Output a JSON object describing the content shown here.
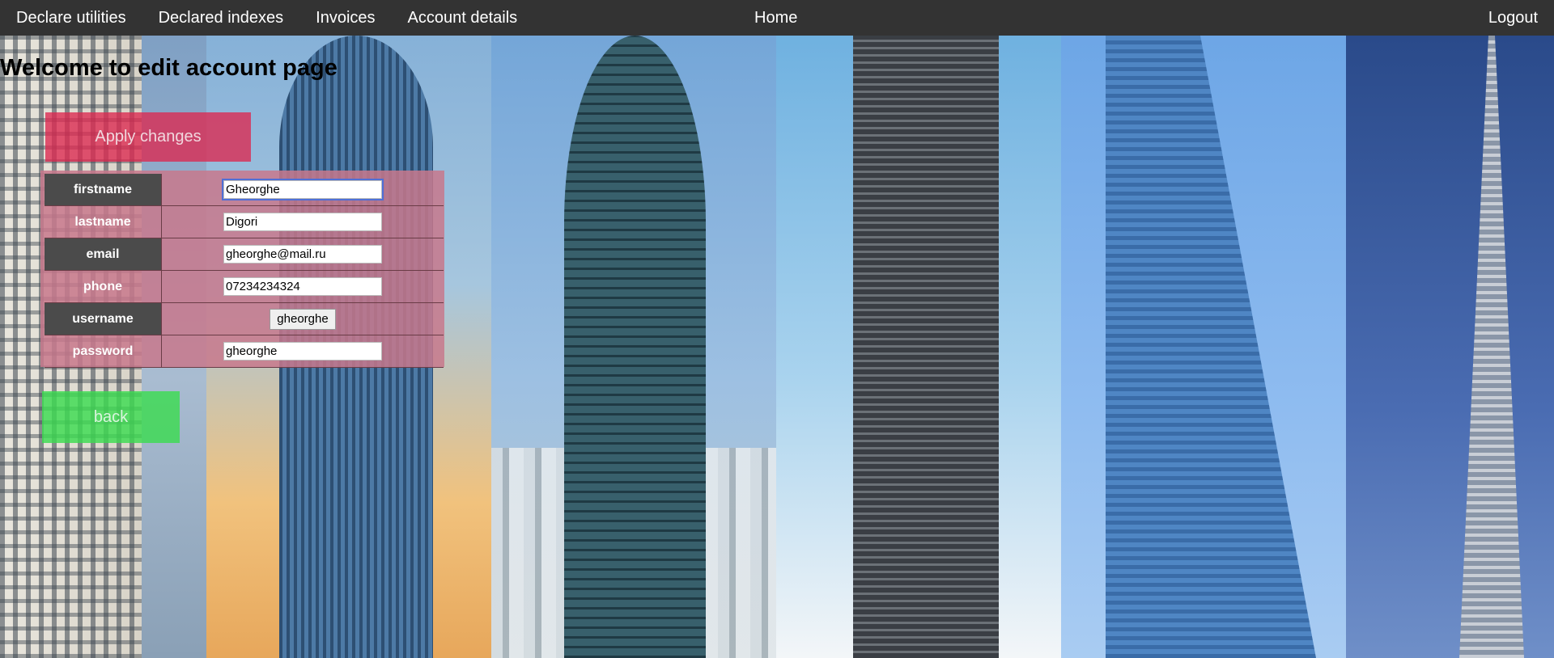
{
  "nav": {
    "declare_utilities": "Declare utilities",
    "declared_indexes": "Declared indexes",
    "invoices": "Invoices",
    "account_details": "Account details",
    "home": "Home",
    "logout": "Logout"
  },
  "page": {
    "title": "Welcome to edit account page",
    "apply_button": "Apply changes",
    "back_button": "back"
  },
  "fields": [
    {
      "label": "firstname",
      "value": "Gheorghe"
    },
    {
      "label": "lastname",
      "value": "Digori"
    },
    {
      "label": "email",
      "value": "gheorghe@mail.ru"
    },
    {
      "label": "phone",
      "value": "07234234324"
    },
    {
      "label": "username",
      "value": "gheorghe"
    },
    {
      "label": "password",
      "value": "gheorghe"
    }
  ],
  "colors": {
    "nav_bg": "#333333",
    "apply_button_bg": "#dc2850",
    "form_bg": "#c8788c",
    "back_button_bg": "#3cdc50"
  }
}
